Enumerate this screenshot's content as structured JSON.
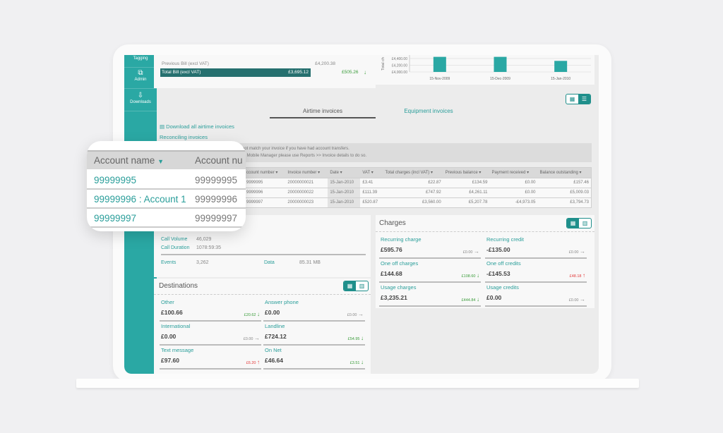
{
  "sidebar": {
    "items": [
      {
        "label": "Tagging",
        "icon": "tag-icon"
      },
      {
        "label": "Admin",
        "icon": "admin-icon"
      },
      {
        "label": "Downloads",
        "icon": "download-icon"
      }
    ]
  },
  "bill": {
    "previous_label": "Previous Bill (excl VAT)",
    "previous_value": "£4,200.38",
    "total_label": "Total Bill (excl VAT)",
    "total_value": "£3,695.12",
    "change": "£505.26",
    "change_dir": "down"
  },
  "chart_data": {
    "type": "bar",
    "ylabel": "Total ch",
    "categories": [
      "15-Nov-2009",
      "15-Dec-2009",
      "15-Jan-2010"
    ],
    "values": [
      4450,
      4450,
      4330
    ],
    "yticks": [
      "£4,400.00",
      "£4,200.00",
      "£4,000.00"
    ],
    "ylim": [
      4000,
      4400
    ],
    "color": "#2aa8a4"
  },
  "tabs": [
    {
      "label": "Airtime invoices",
      "active": true
    },
    {
      "label": "Equipment invoices",
      "active": false
    }
  ],
  "links": {
    "download": "Download all airtime invoices",
    "reconciling": "Reconciling invoices"
  },
  "notice": {
    "line1": "not match your invoice if you have had account transfers.",
    "line2": "th Mobile Manager please use Reports >> Invoice details to do so."
  },
  "invoice_table": {
    "headers": [
      "ccount number ▾",
      "Invoice number ▾",
      "Date ▾",
      "VAT ▾",
      "Total charges (incl VAT) ▾",
      "Previous balance ▾",
      "Payment received ▾",
      "Balance outstanding ▾"
    ],
    "rows": [
      [
        "9999995",
        "20000000021",
        "15-Jan-2010",
        "£3.41",
        "£22.87",
        "£134.59",
        "£0.00",
        "£157.46"
      ],
      [
        "9999996",
        "20000000022",
        "15-Jan-2010",
        "£111.39",
        "£747.92",
        "£4,261.11",
        "£0.00",
        "£5,009.03"
      ],
      [
        "9999997",
        "20000000023",
        "15-Jan-2010",
        "£520.87",
        "£3,560.00",
        "£5,207.78",
        "-£4,973.05",
        "£3,794.73"
      ]
    ]
  },
  "popup": {
    "headers": [
      "Account name",
      "Account nu"
    ],
    "rows": [
      [
        "99999995",
        "99999995"
      ],
      [
        "99999996 : Account 1",
        "99999996"
      ],
      [
        "99999997",
        "99999997"
      ]
    ]
  },
  "usage": {
    "call_volume_label": "Call Volume",
    "call_volume": "46,029",
    "call_duration_label": "Call Duration",
    "call_duration": "1078:59:35",
    "events_label": "Events",
    "events": "3,262",
    "data_label": "Data",
    "data": "85.31 MB"
  },
  "destinations": {
    "title": "Destinations",
    "items": [
      {
        "label": "Other",
        "value": "£100.66",
        "change": "£20.62",
        "dir": "down"
      },
      {
        "label": "Answer phone",
        "value": "£0.00",
        "change": "£0.00",
        "dir": "flat"
      },
      {
        "label": "International",
        "value": "£0.00",
        "change": "£0.00",
        "dir": "flat"
      },
      {
        "label": "Landline",
        "value": "£724.12",
        "change": "£54.95",
        "dir": "down"
      },
      {
        "label": "Text message",
        "value": "£97.60",
        "change": "£6.20",
        "dir": "up"
      },
      {
        "label": "On Net",
        "value": "£46.64",
        "change": "£3.51",
        "dir": "down"
      }
    ]
  },
  "charges": {
    "title": "Charges",
    "items": [
      {
        "label": "Recurring charge",
        "value": "£595.76",
        "change": "£0.00",
        "dir": "flat"
      },
      {
        "label": "Recurring credit",
        "value": "-£135.00",
        "change": "£0.00",
        "dir": "flat"
      },
      {
        "label": "One off charges",
        "value": "£144.68",
        "change": "£108.60",
        "dir": "down"
      },
      {
        "label": "One off credits",
        "value": "-£145.53",
        "change": "£48.18",
        "dir": "up"
      },
      {
        "label": "Usage charges",
        "value": "£3,235.21",
        "change": "£444.84",
        "dir": "down"
      },
      {
        "label": "Usage credits",
        "value": "£0.00",
        "change": "£0.00",
        "dir": "flat"
      }
    ]
  },
  "colors": {
    "teal": "#2aa8a4",
    "dark_teal": "#26706f",
    "green": "#3a9c3a",
    "red": "#e23a3a"
  }
}
